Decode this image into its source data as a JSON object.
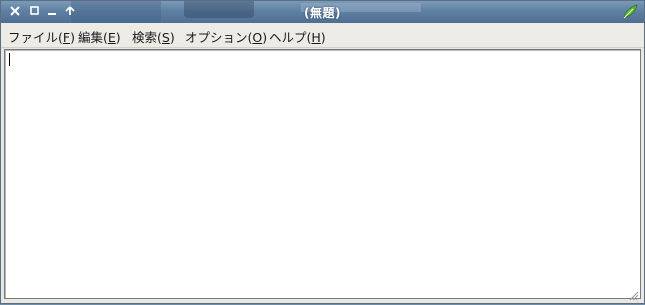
{
  "window": {
    "title": "(無題)"
  },
  "titlebar": {
    "buttons": [
      {
        "name": "close-icon",
        "glyph": "✕"
      },
      {
        "name": "maximize-icon",
        "glyph": "□"
      },
      {
        "name": "minimize-icon",
        "glyph": "_"
      },
      {
        "name": "shade-up-icon",
        "glyph": "↑"
      }
    ],
    "app_icon": "leafpad-icon"
  },
  "menubar": {
    "items": [
      {
        "label": "ファイル(",
        "accel": "F",
        "suffix": ")"
      },
      {
        "label": "編集(",
        "accel": "E",
        "suffix": ")"
      },
      {
        "label": "検索(",
        "accel": "S",
        "suffix": ")"
      },
      {
        "label": "オプション(",
        "accel": "O",
        "suffix": ")"
      },
      {
        "label": "ヘルプ(",
        "accel": "H",
        "suffix": ")"
      }
    ]
  },
  "editor": {
    "content": ""
  },
  "colors": {
    "titlebar": "#5f80a3",
    "menubar": "#ecebe6",
    "editor_bg": "#ffffff"
  }
}
